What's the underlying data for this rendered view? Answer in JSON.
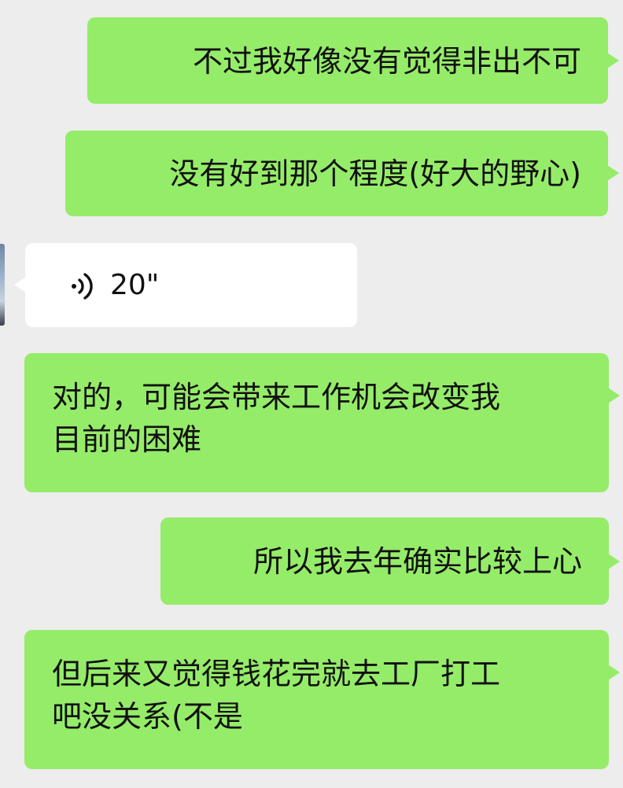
{
  "theme": {
    "background": "#ededed",
    "sent_bubble": "#95ec69",
    "received_bubble": "#ffffff"
  },
  "messages": [
    {
      "direction": "sent",
      "type": "text",
      "text": "不过我好像没有觉得非出不可"
    },
    {
      "direction": "sent",
      "type": "text",
      "text": "没有好到那个程度(好大的野心)"
    },
    {
      "direction": "received",
      "type": "voice",
      "duration": "20\"",
      "icon": "voice-wave-icon"
    },
    {
      "direction": "sent",
      "type": "text",
      "lines": [
        "对的，可能会带来工作机会改变我",
        "目前的困难"
      ]
    },
    {
      "direction": "sent",
      "type": "text",
      "text": "所以我去年确实比较上心"
    },
    {
      "direction": "sent",
      "type": "text",
      "lines": [
        "但后来又觉得钱花完就去工厂打工",
        "吧没关系(不是"
      ]
    }
  ]
}
